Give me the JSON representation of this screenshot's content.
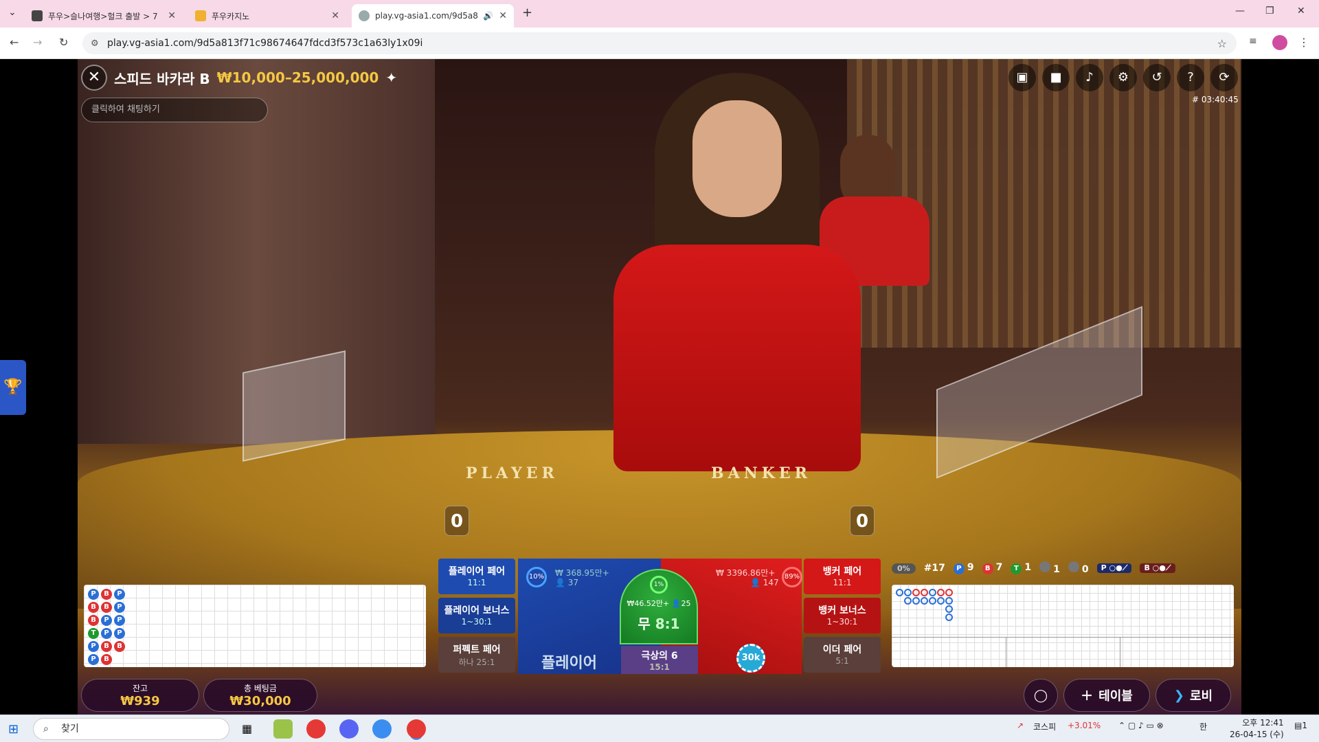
{
  "browser": {
    "tabs": [
      {
        "title": "푸우>슬나여행>헐크 출발 > 7",
        "close": "✕"
      },
      {
        "title": "푸우카지노",
        "close": "✕"
      },
      {
        "title": "play.vg-asia1.com/9d5a81",
        "close": "✕"
      }
    ],
    "new_tab": "+",
    "url": "play.vg-asia1.com/9d5a813f71c98674647fdcd3f573c1a63ly1x09i"
  },
  "game": {
    "name": "스피드 바카라 B",
    "limits": "₩10,000–25,000,000",
    "chat_placeholder": "클릭하여 채팅하기",
    "round_id": "# 03:40:45",
    "felt_player": "PLAYER",
    "felt_banker": "BANKER",
    "player_score": "0",
    "banker_score": "0"
  },
  "stats": {
    "pct": "0%",
    "round": "#17",
    "p": "9",
    "b": "7",
    "t": "1",
    "pp": "1",
    "bp": "0"
  },
  "bets": {
    "player_pair": {
      "label": "플레이어 페어",
      "odds": "11:1"
    },
    "player_bonus": {
      "label": "플레이어 보너스",
      "odds": "1~30:1"
    },
    "perfect_pair": {
      "label": "퍼펙트 페어",
      "odds": "하나 25:1"
    },
    "player": {
      "label": "플레이어",
      "amount": "₩ 368.95만+",
      "players": "37",
      "pct": "10%"
    },
    "tie": {
      "label": "무",
      "odds": "8:1",
      "amount": "₩46.52만+",
      "players": "25",
      "pct": "1%"
    },
    "banker": {
      "amount": "₩ 3396.86만+",
      "players": "147",
      "pct": "89%",
      "chip": "30k"
    },
    "super6": {
      "label": "극상의 6",
      "odds": "15:1"
    },
    "banker_pair": {
      "label": "뱅커 페어",
      "odds": "11:1"
    },
    "banker_bonus": {
      "label": "뱅커 보너스",
      "odds": "1~30:1"
    },
    "either_pair": {
      "label": "이더 페어",
      "odds": "5:1"
    }
  },
  "wallet": {
    "balance_label": "잔고",
    "balance": "₩939",
    "total_label": "총 베팅금",
    "total": "₩30,000"
  },
  "buttons": {
    "table": "테이블",
    "lobby": "로비"
  },
  "bead_road": [
    [
      "P",
      "B",
      "P"
    ],
    [
      "B",
      "B",
      "P"
    ],
    [
      "B",
      "P",
      "P"
    ],
    [
      "T",
      "P",
      "P"
    ],
    [
      "P",
      "B",
      "B"
    ],
    [
      "P",
      "B",
      ""
    ]
  ],
  "taskbar": {
    "search": "찾기",
    "kospi_label": "코스피",
    "kospi_change": "+3.01%",
    "time": "오후 12:41",
    "date": "26-04-15 (수)",
    "ime": "한",
    "notif": "1"
  },
  "colors": {
    "player": "#1e4bb0",
    "banker": "#d41818",
    "tie": "#1f9a2e",
    "gold": "#f5c842"
  }
}
